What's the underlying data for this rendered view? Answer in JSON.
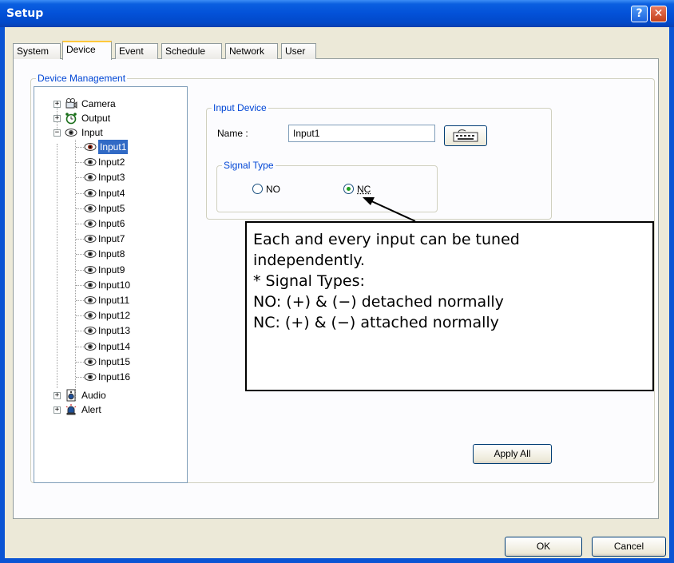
{
  "window": {
    "title": "Setup",
    "help_icon": "question-mark-icon",
    "close_icon": "close-x-icon"
  },
  "tabs": [
    {
      "label": "System",
      "active": false
    },
    {
      "label": "Device",
      "active": true
    },
    {
      "label": "Event",
      "active": false
    },
    {
      "label": "Schedule",
      "active": false
    },
    {
      "label": "Network",
      "active": false
    },
    {
      "label": "User",
      "active": false
    }
  ],
  "device_management": {
    "group_label": "Device Management",
    "tree": {
      "camera": "Camera",
      "output": "Output",
      "input": "Input",
      "inputs": [
        "Input1",
        "Input2",
        "Input3",
        "Input4",
        "Input5",
        "Input6",
        "Input7",
        "Input8",
        "Input9",
        "Input10",
        "Input11",
        "Input12",
        "Input13",
        "Input14",
        "Input15",
        "Input16"
      ],
      "selected": "Input1",
      "audio": "Audio",
      "alert": "Alert"
    }
  },
  "input_device": {
    "group_label": "Input Device",
    "name_label": "Name :",
    "name_value": "Input1",
    "keyboard_icon": "keyboard-icon",
    "signal_type": {
      "group_label": "Signal Type",
      "options": [
        "NO",
        "NC"
      ],
      "selected": "NC"
    }
  },
  "callout": {
    "lines": [
      "Each and every input can be tuned",
      "independently.",
      "* Signal Types:",
      "NO: (+) & (−) detached normally",
      "NC: (+) & (−) attached normally"
    ]
  },
  "buttons": {
    "apply_all": "Apply All",
    "ok": "OK",
    "cancel": "Cancel"
  },
  "colors": {
    "title_bar": "#0a54d4",
    "selection": "#316ac5",
    "group_label": "#0046d5"
  }
}
